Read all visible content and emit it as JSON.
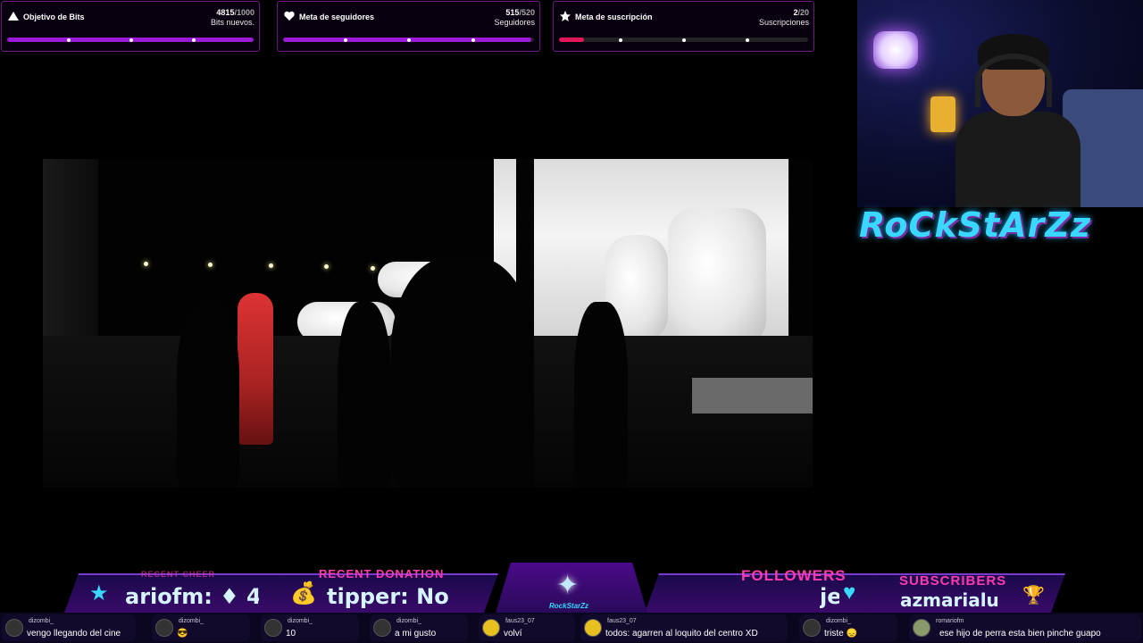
{
  "goals": [
    {
      "title": "Objetivo de Bits",
      "count": "4815/1000",
      "current": "4815",
      "target": "1000",
      "subtitle": "Bits nuevos.",
      "progress": 1.0,
      "color": "#9a1ad8",
      "icon": "triangle-icon"
    },
    {
      "title": "Meta de seguidores",
      "count": "515/520",
      "current": "515",
      "target": "520",
      "subtitle": "Seguidores",
      "progress": 0.99,
      "color": "#9a1ad8",
      "icon": "heart-icon"
    },
    {
      "title": "Meta de suscripción",
      "count": "2/20",
      "current": "2",
      "target": "20",
      "subtitle": "Suscripciones",
      "progress": 0.1,
      "color": "#e0185a",
      "icon": "star-icon"
    }
  ],
  "logo_text": "RoCkStArZz",
  "bottom_bar": {
    "recent_cheer": {
      "label": "RECENT CHEER",
      "value": "ariofm: ♦ 4"
    },
    "recent_donation": {
      "label": "RECENT DONATION",
      "value": "tipper: No"
    },
    "center_logo": "RockStarZz",
    "followers": {
      "label": "FOLLOWERS",
      "value": "je"
    },
    "subscribers": {
      "label": "SUBSCRIBERS",
      "value": "azmarialu"
    }
  },
  "chat": [
    {
      "user": "dizombi_",
      "text": "vengo llegando del cine"
    },
    {
      "user": "dizombi_",
      "text": "😎"
    },
    {
      "user": "dizombi_",
      "text": "10"
    },
    {
      "user": "dizombi_",
      "text": "a mi gusto"
    },
    {
      "user": "faus23_07",
      "text": "volví"
    },
    {
      "user": "faus23_07",
      "text": "todos: agarren al loquito del centro XD"
    },
    {
      "user": "dizombi_",
      "text": "triste 😞"
    },
    {
      "user": "romariofm",
      "text": "ese hijo de perra esta bien pinche guapo"
    }
  ],
  "colors": {
    "accent": "#9a1ad8",
    "sub_goal": "#e0185a",
    "neon_blue": "#3ad8ff",
    "neon_pink": "#ff3ab0"
  }
}
